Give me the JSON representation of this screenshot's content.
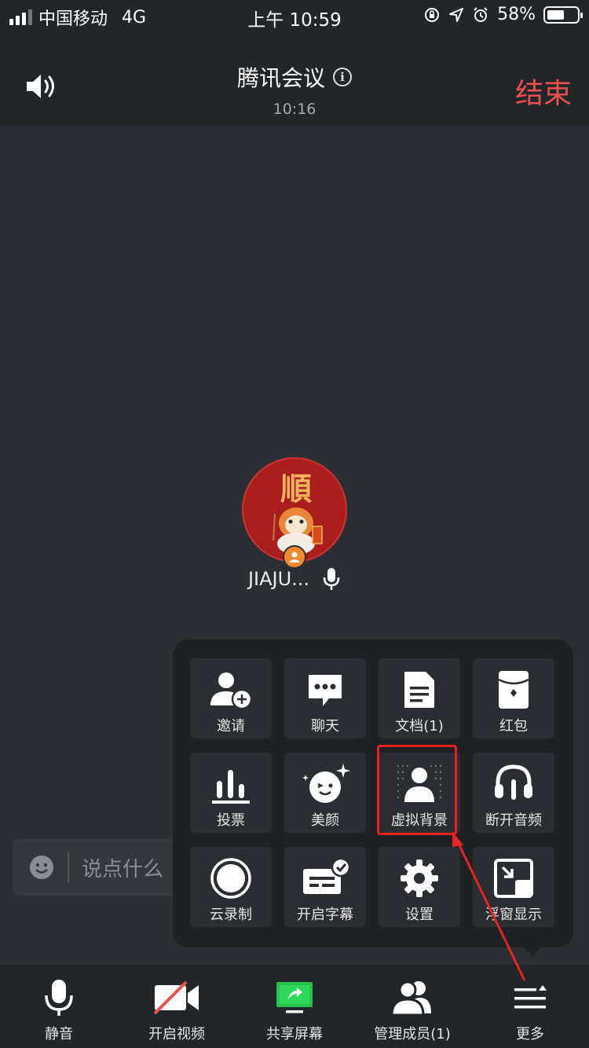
{
  "status_bar": {
    "carrier": "中国移动",
    "network": "4G",
    "time": "上午 10:59",
    "battery_percent": "58%",
    "battery_level": 0.58
  },
  "header": {
    "title": "腾讯会议",
    "timer": "10:16",
    "end_label": "结束"
  },
  "participant": {
    "name": "JIAJU...",
    "avatar_char": "順"
  },
  "chat": {
    "placeholder": "说点什么"
  },
  "more_panel": {
    "items": [
      {
        "label": "邀请",
        "icon": "invite-icon"
      },
      {
        "label": "聊天",
        "icon": "chat-icon"
      },
      {
        "label": "文档(1)",
        "icon": "document-icon"
      },
      {
        "label": "红包",
        "icon": "red-packet-icon"
      },
      {
        "label": "投票",
        "icon": "vote-icon"
      },
      {
        "label": "美颜",
        "icon": "beauty-icon"
      },
      {
        "label": "虚拟背景",
        "icon": "virtual-background-icon"
      },
      {
        "label": "断开音频",
        "icon": "headphones-icon"
      },
      {
        "label": "云录制",
        "icon": "cloud-record-icon"
      },
      {
        "label": "开启字幕",
        "icon": "subtitles-icon"
      },
      {
        "label": "设置",
        "icon": "gear-icon"
      },
      {
        "label": "浮窗显示",
        "icon": "floating-window-icon"
      }
    ],
    "highlight_color": "#e8231f"
  },
  "toolbar": {
    "items": [
      {
        "label": "静音",
        "icon": "microphone-icon"
      },
      {
        "label": "开启视频",
        "icon": "video-off-icon"
      },
      {
        "label": "共享屏幕",
        "icon": "share-screen-icon"
      },
      {
        "label": "管理成员(1)",
        "icon": "members-icon"
      },
      {
        "label": "更多",
        "icon": "more-icon"
      }
    ]
  },
  "colors": {
    "end_red": "#e8514d",
    "share_green": "#27c24c",
    "host_orange": "#f08a2c"
  }
}
